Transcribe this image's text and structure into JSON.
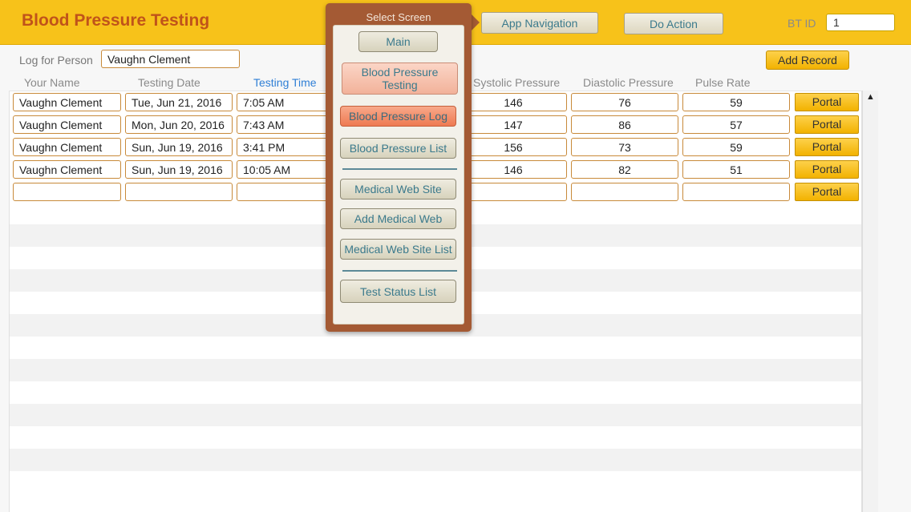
{
  "header": {
    "title": "Blood Pressure Testing",
    "app_navigation_label": "App Navigation",
    "do_action_label": "Do Action",
    "bt_id_label": "BT ID",
    "bt_id_value": "1"
  },
  "log_for_person": {
    "label": "Log for Person",
    "value": "Vaughn Clement"
  },
  "add_record_label": "Add Record",
  "columns": {
    "your_name": "Your Name",
    "testing_date": "Testing Date",
    "testing_time": "Testing Time",
    "systolic": "Systolic Pressure",
    "diastolic": "Diastolic Pressure",
    "pulse": "Pulse Rate"
  },
  "rows": [
    {
      "name": "Vaughn Clement",
      "date": "Tue, Jun 21, 2016",
      "time": "7:05 AM",
      "systolic": "146",
      "diastolic": "76",
      "pulse": "59",
      "portal": "Portal"
    },
    {
      "name": "Vaughn Clement",
      "date": "Mon, Jun 20, 2016",
      "time": "7:43 AM",
      "systolic": "147",
      "diastolic": "86",
      "pulse": "57",
      "portal": "Portal"
    },
    {
      "name": "Vaughn Clement",
      "date": "Sun, Jun 19, 2016",
      "time": "3:41 PM",
      "systolic": "156",
      "diastolic": "73",
      "pulse": "59",
      "portal": "Portal"
    },
    {
      "name": "Vaughn Clement",
      "date": "Sun, Jun 19, 2016",
      "time": "10:05 AM",
      "systolic": "146",
      "diastolic": "82",
      "pulse": "51",
      "portal": "Portal"
    },
    {
      "name": "",
      "date": "",
      "time": "",
      "systolic": "",
      "diastolic": "",
      "pulse": "",
      "portal": "Portal"
    }
  ],
  "scroll_up_glyph": "▲",
  "select_screen": {
    "title": "Select Screen",
    "items": {
      "main": "Main",
      "bp_testing_line1": "Blood Pressure",
      "bp_testing_line2": "Testing",
      "bp_log": "Blood Pressure Log",
      "bp_list": "Blood Pressure List",
      "medical_web_site": "Medical Web Site",
      "add_medical_web": "Add Medical Web",
      "medical_web_site_list": "Medical Web Site List",
      "test_status_list": "Test Status List"
    }
  },
  "colors": {
    "header_bg": "#f7c21a",
    "title_color": "#c0531a",
    "popover_bg": "#a45a34",
    "active_column": "#2f7fd6"
  }
}
